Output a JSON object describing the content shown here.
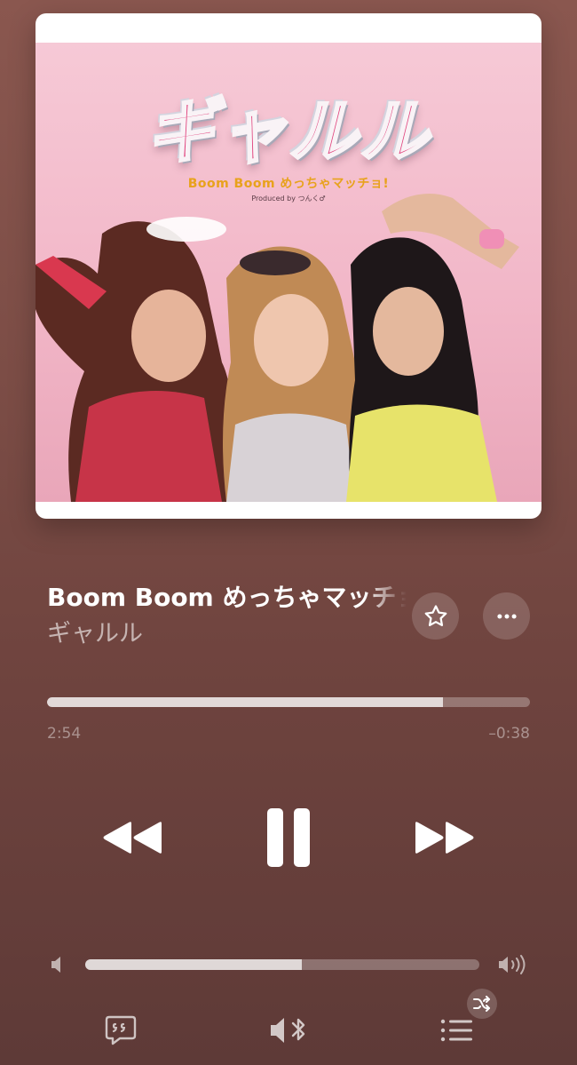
{
  "artwork": {
    "logo_text": "ギャルル",
    "subtitle": "Boom Boom めっちゃマッチョ!",
    "credit": "Produced by つんく♂"
  },
  "track": {
    "title": "Boom Boom めっちゃマッチョ!",
    "artist": "ギャルル"
  },
  "actions": {
    "favorite_icon": "star-outline-icon",
    "more_icon": "ellipsis-icon"
  },
  "playback": {
    "elapsed": "2:54",
    "remaining": "–0:38",
    "progress_fraction": 0.82,
    "state": "playing"
  },
  "volume": {
    "level_fraction": 0.55
  },
  "bottom_bar": {
    "lyrics_icon": "lyrics-quote-bubble-icon",
    "audio_output_icon": "speaker-bluetooth-icon",
    "queue_icon": "queue-list-icon",
    "shuffle_icon": "shuffle-icon"
  },
  "colors": {
    "background_top": "#8a574f",
    "background_bottom": "#5e3a37",
    "accent_pink": "#e0407b"
  }
}
